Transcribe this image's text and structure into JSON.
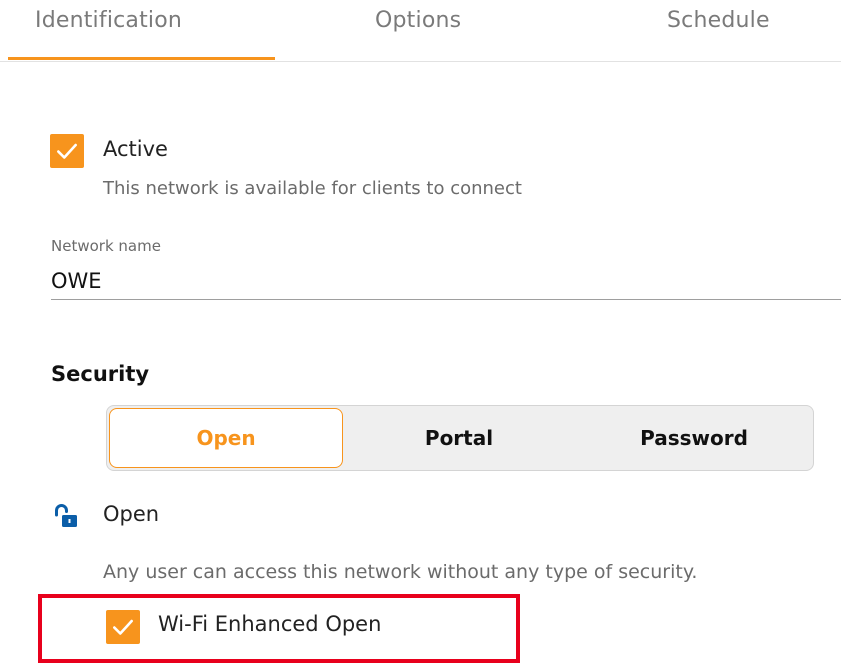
{
  "tabs": [
    {
      "label": "Identification",
      "active": true
    },
    {
      "label": "Options",
      "active": false
    },
    {
      "label": "Schedule",
      "active": false
    }
  ],
  "active_toggle": {
    "label": "Active",
    "checked": true,
    "description": "This network is available for clients to connect"
  },
  "network_name": {
    "label": "Network name",
    "value": "OWE"
  },
  "security": {
    "heading": "Security",
    "options": [
      "Open",
      "Portal",
      "Password"
    ],
    "selected": "Open",
    "mode_title": "Open",
    "mode_icon": "unlock-icon",
    "mode_description": "Any user can access this network without any type of security.",
    "enhanced_open": {
      "label": "Wi-Fi Enhanced Open",
      "checked": true
    }
  },
  "colors": {
    "accent": "#f7941d",
    "icon_blue": "#0b5ea8",
    "highlight_red": "#e8001c"
  }
}
